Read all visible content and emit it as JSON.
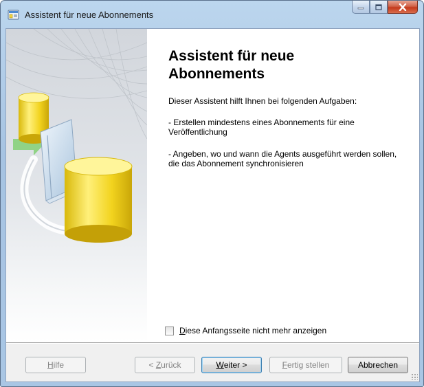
{
  "window": {
    "title": "Assistent für neue Abonnements",
    "icon": "wizard-app-icon"
  },
  "caption_buttons": {
    "minimize_icon": "minimize-icon",
    "maximize_icon": "maximize-icon",
    "close_icon": "close-icon"
  },
  "side_art": {
    "icon": "database-replication-illustration"
  },
  "content": {
    "heading": "Assistent für neue Abonnements",
    "intro": "Dieser Assistent hilft Ihnen bei folgenden Aufgaben:",
    "bullets": [
      "- Erstellen mindestens eines Abonnements für eine Veröffentlichung",
      "- Angeben, wo und wann die Agents ausgeführt werden sollen, die das Abonnement synchronisieren"
    ]
  },
  "checkbox": {
    "mnemonic": "D",
    "label_rest": "iese Anfangsseite nicht mehr anzeigen",
    "checked": false
  },
  "buttons": {
    "help": {
      "mnemonic": "H",
      "rest": "ilfe",
      "enabled": false
    },
    "back": {
      "prefix": "< ",
      "mnemonic": "Z",
      "rest": "urück",
      "enabled": false
    },
    "next": {
      "mnemonic": "W",
      "rest": "eiter >",
      "enabled": true
    },
    "finish": {
      "mnemonic": "F",
      "rest": "ertig stellen",
      "enabled": false
    },
    "cancel": {
      "label": "Abbrechen",
      "enabled": true
    }
  },
  "colors": {
    "accent_cylinder": "#f0d020",
    "title_bar": "#bcd6ee",
    "close_button": "#c4391b"
  }
}
